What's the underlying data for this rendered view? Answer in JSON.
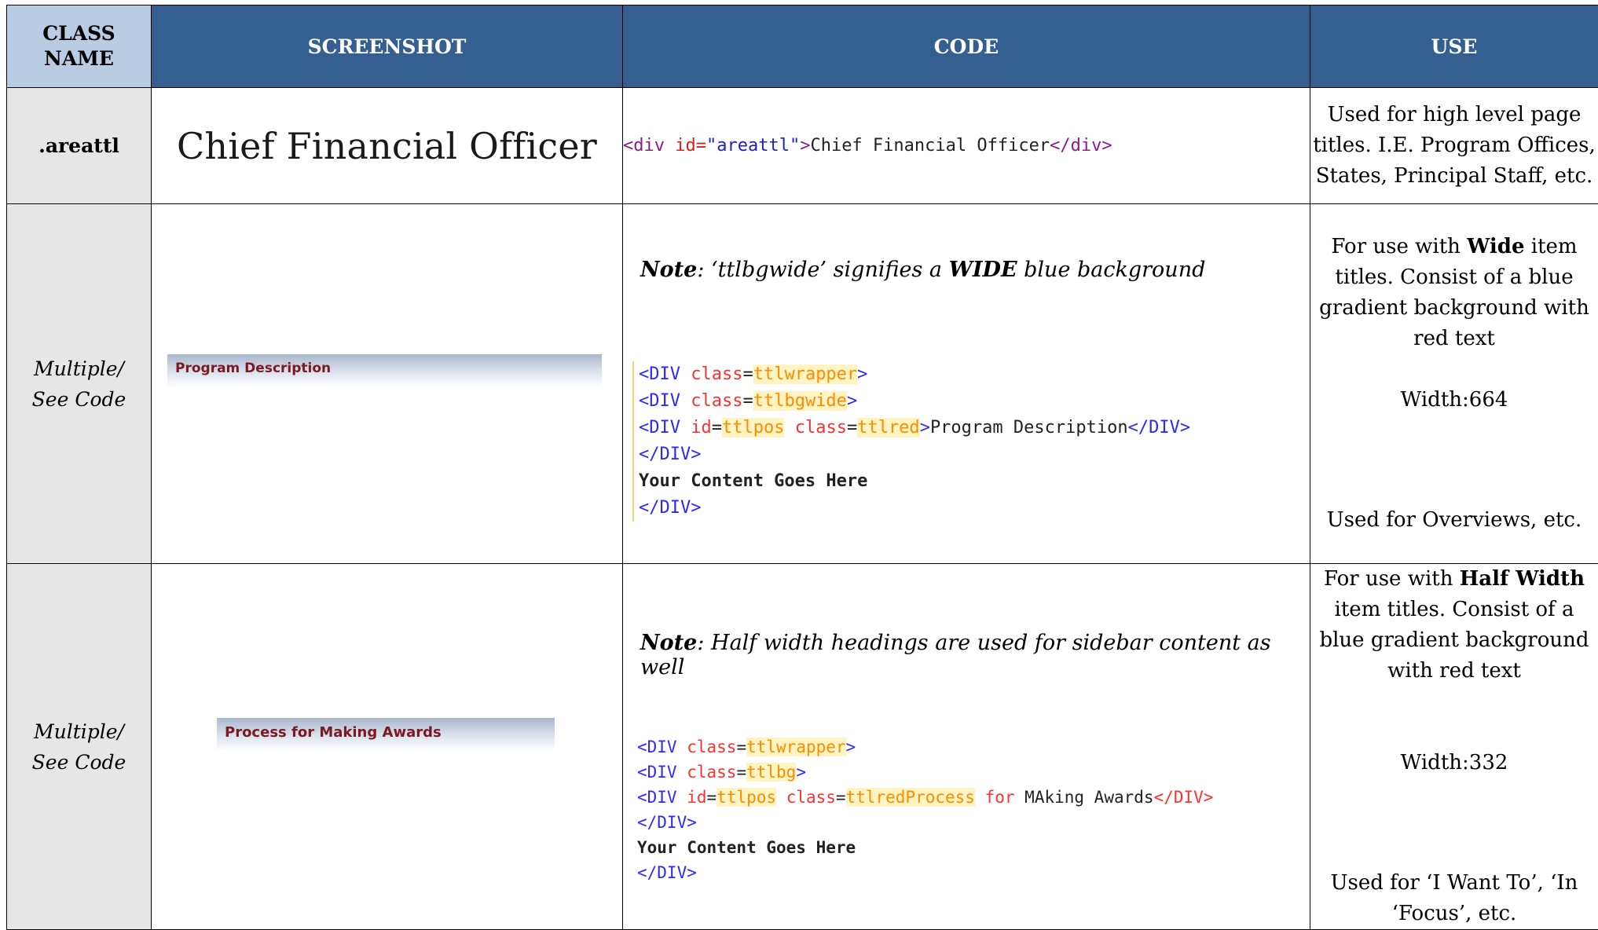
{
  "headers": {
    "class_name": "CLASS NAME",
    "screenshot": "SCREENSHOT",
    "code": "CODE",
    "use": "USE"
  },
  "row1": {
    "class_name": ".areattl",
    "screenshot_text": "Chief Financial Officer",
    "code": {
      "open_tag": "<div",
      "attr": "id=",
      "value": "\"areattl\"",
      "close_bracket": ">",
      "content": "Chief Financial Officer",
      "end_tag": "</div>"
    },
    "use_lines": [
      "Used for high level page titles. I.E. Program Offices, States, Principal Staff, etc."
    ]
  },
  "row2": {
    "class_name_1": "Multiple/",
    "class_name_2": "See Code",
    "screenshot_text": "Program Description",
    "note_label": "Note",
    "note_text_1": ": ‘ttlbgwide’ signifies a ",
    "note_bold": "WIDE",
    "note_text_2": " blue background",
    "code_lines": {
      "l1_tag": "<DIV",
      "l1_attr": "class",
      "l1_eq": "=",
      "l1_val": "ttlwrapper",
      "l1_close": ">",
      "l2_tag": "<DIV",
      "l2_attr": "class",
      "l2_eq": "=",
      "l2_val": "ttlbgwide",
      "l2_close": ">",
      "l3_tag": "<DIV",
      "l3_attr1": "id",
      "l3_eq1": "=",
      "l3_val1": "ttlpos",
      "l3_attr2": "class",
      "l3_eq2": "=",
      "l3_val2": "ttlred",
      "l3_close": ">",
      "l3_content": "Program Description",
      "l3_end": "</DIV>",
      "l4": "</DIV>",
      "l5": "Your Content Goes Here",
      "l6": "</DIV>"
    },
    "use": {
      "line1_pre": "For use with ",
      "line1_bold": "Wide",
      "line1_post": " item titles. Consist of a blue gradient background with red text",
      "width": "Width:664",
      "used_for": "Used for Overviews, etc."
    }
  },
  "row3": {
    "class_name_1": "Multiple/",
    "class_name_2": "See Code",
    "screenshot_text": "Process for Making Awards",
    "note_label": "Note",
    "note_text": ": Half width headings are used for sidebar content as well",
    "code_lines": {
      "l1_tag": "<DIV",
      "l1_attr": "class",
      "l1_eq": "=",
      "l1_val": "ttlwrapper",
      "l1_close": ">",
      "l2_tag": "<DIV",
      "l2_attr": "class",
      "l2_eq": "=",
      "l2_val": "ttlbg",
      "l2_close": ">",
      "l3_tag": "<DIV",
      "l3_attr1": "id",
      "l3_eq1": "=",
      "l3_val1": "ttlpos",
      "l3_attr2": "class",
      "l3_eq2": "=",
      "l3_val2": "ttlredProcess",
      "l3_mid": " for ",
      "l3_content": "MAking Awards",
      "l3_end": "</DIV>",
      "l4": "</DIV>",
      "l5": "Your Content Goes Here",
      "l6": "</DIV>"
    },
    "use": {
      "line1_pre": "For use with ",
      "line1_bold": "Half Width",
      "line1_post": " item titles. Consist of a blue gradient background with  red text",
      "width": "Width:332",
      "used_for": "Used for ‘I Want To’, ‘In ‘Focus’, etc."
    }
  }
}
